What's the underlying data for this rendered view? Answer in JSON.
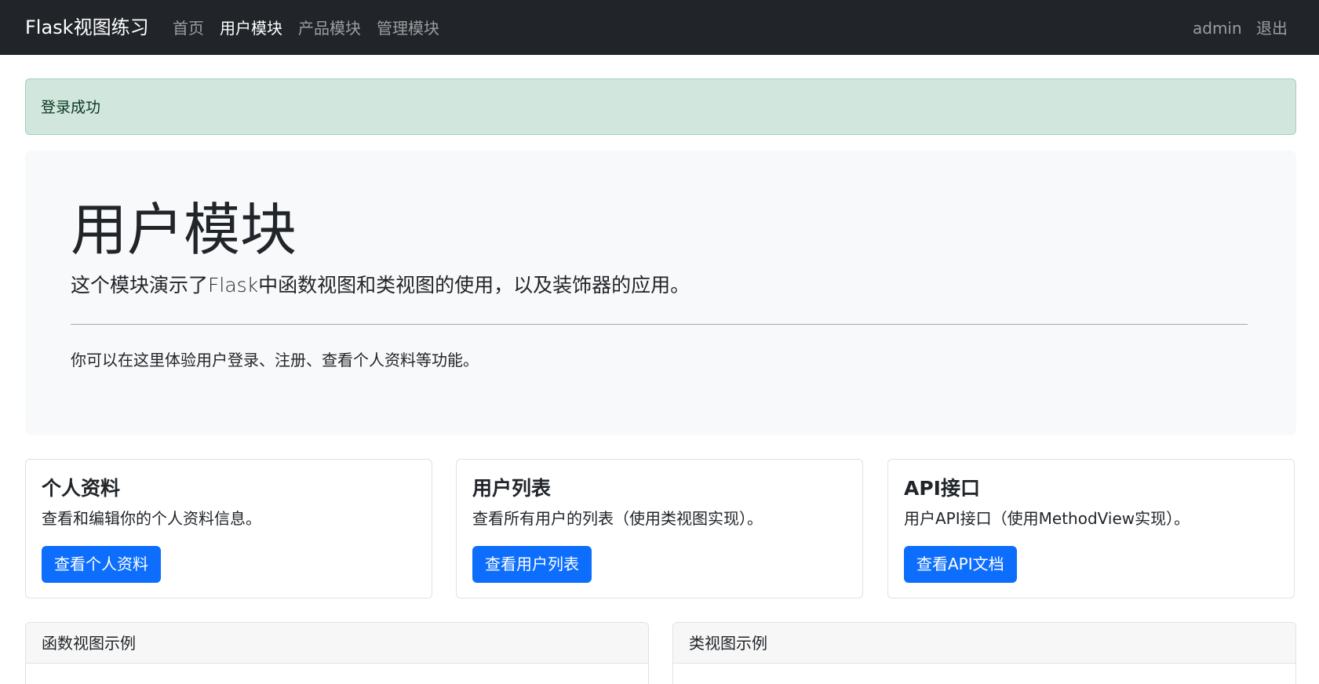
{
  "navbar": {
    "brand": "Flask视图练习",
    "links": [
      {
        "label": "首页",
        "active": false
      },
      {
        "label": "用户模块",
        "active": true
      },
      {
        "label": "产品模块",
        "active": false
      },
      {
        "label": "管理模块",
        "active": false
      }
    ],
    "user": "admin",
    "logout": "退出"
  },
  "alert": {
    "message": "登录成功"
  },
  "hero": {
    "title": "用户模块",
    "lead": "这个模块演示了Flask中函数视图和类视图的使用，以及装饰器的应用。",
    "text": "你可以在这里体验用户登录、注册、查看个人资料等功能。"
  },
  "cards": [
    {
      "title": "个人资料",
      "text": "查看和编辑你的个人资料信息。",
      "button": "查看个人资料"
    },
    {
      "title": "用户列表",
      "text": "查看所有用户的列表（使用类视图实现）。",
      "button": "查看用户列表"
    },
    {
      "title": "API接口",
      "text": "用户API接口（使用MethodView实现）。",
      "button": "查看API文档"
    }
  ],
  "panels": [
    {
      "title": "函数视图示例"
    },
    {
      "title": "类视图示例"
    }
  ],
  "colors": {
    "navbar_bg": "#212529",
    "primary": "#0d6efd",
    "alert_success_bg": "#d1e7dd",
    "hero_bg": "#f8f9fa"
  }
}
